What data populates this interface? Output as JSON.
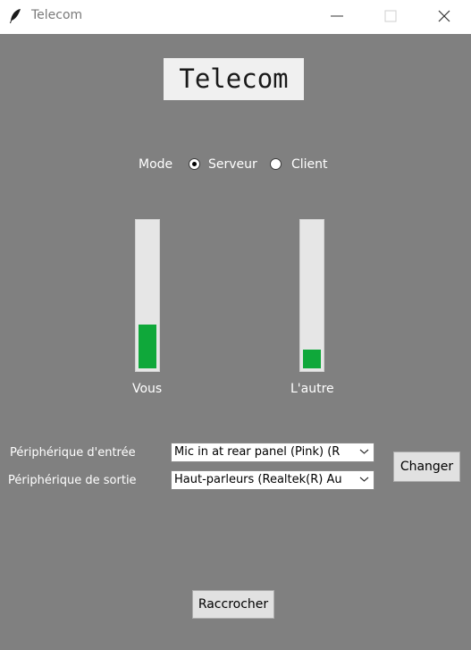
{
  "window": {
    "title": "Telecom",
    "app_icon": "feather-icon",
    "controls": [
      "minimize-icon",
      "maximize-icon",
      "close-icon"
    ]
  },
  "app": {
    "heading": "Telecom"
  },
  "mode": {
    "label": "Mode",
    "options": [
      {
        "label": "Serveur",
        "selected": true
      },
      {
        "label": "Client",
        "selected": false
      }
    ]
  },
  "meters": [
    {
      "label": "Vous",
      "level": 0.3
    },
    {
      "label": "L'autre",
      "level": 0.13
    }
  ],
  "devices": {
    "input_label": "Périphérique d'entrée",
    "input_value": "Mic in at rear panel (Pink) (R",
    "output_label": "Périphérique de sortie",
    "output_value": "Haut-parleurs (Realtek(R) Au",
    "change_label": "Changer"
  },
  "hangup_label": "Raccrocher",
  "colors": {
    "background": "#808080",
    "meter_fill": "#0fa83a"
  }
}
